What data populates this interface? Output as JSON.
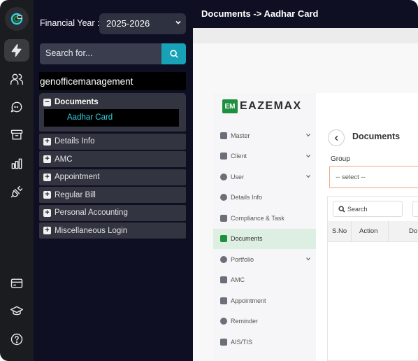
{
  "rail": {
    "items": [
      {
        "icon": "lightning-icon",
        "active": true
      },
      {
        "icon": "users-icon"
      },
      {
        "icon": "chat-icon"
      },
      {
        "icon": "archive-icon"
      },
      {
        "icon": "bar-chart-icon"
      },
      {
        "icon": "plug-icon"
      },
      {
        "icon": "card-icon"
      },
      {
        "icon": "graduation-cap-icon"
      },
      {
        "icon": "help-icon"
      }
    ]
  },
  "panel": {
    "fy_label": "Financial Year :",
    "fy_value": "2025-2026",
    "search_placeholder": "Search for...",
    "company": "genofficemanagement",
    "open_node": {
      "label": "Documents",
      "child": "Aadhar Card"
    },
    "nodes": [
      "Details Info",
      "AMC",
      "Appointment",
      "Regular Bill",
      "Personal Accounting",
      "Miscellaneous Login"
    ]
  },
  "topbar": {
    "title": "Documents -> Aadhar Card"
  },
  "app": {
    "brand_mark": "EM",
    "brand_name": "EAZEMAX",
    "menu": [
      {
        "label": "Master",
        "caret": true
      },
      {
        "label": "Client",
        "caret": true
      },
      {
        "label": "User",
        "caret": true
      },
      {
        "label": "Details Info",
        "caret": false
      },
      {
        "label": "Compliance & Task",
        "caret": false
      },
      {
        "label": "Documents",
        "caret": false,
        "active": true
      },
      {
        "label": "Portfolio",
        "caret": true
      },
      {
        "label": "AMC",
        "caret": false
      },
      {
        "label": "Appointment",
        "caret": false
      },
      {
        "label": "Reminder",
        "caret": false
      },
      {
        "label": "AIS/TIS",
        "caret": false
      }
    ],
    "page_title": "Documents",
    "group_label": "Group",
    "group_value": "-- select --",
    "table_search": "Search",
    "columns": [
      "S.No",
      "Action",
      "Do"
    ]
  },
  "colors": {
    "accent": "#17a2b8",
    "brand_green": "#1e8f3e",
    "dark_bg": "#0e0f23",
    "highlight": "#2fd0e0"
  }
}
